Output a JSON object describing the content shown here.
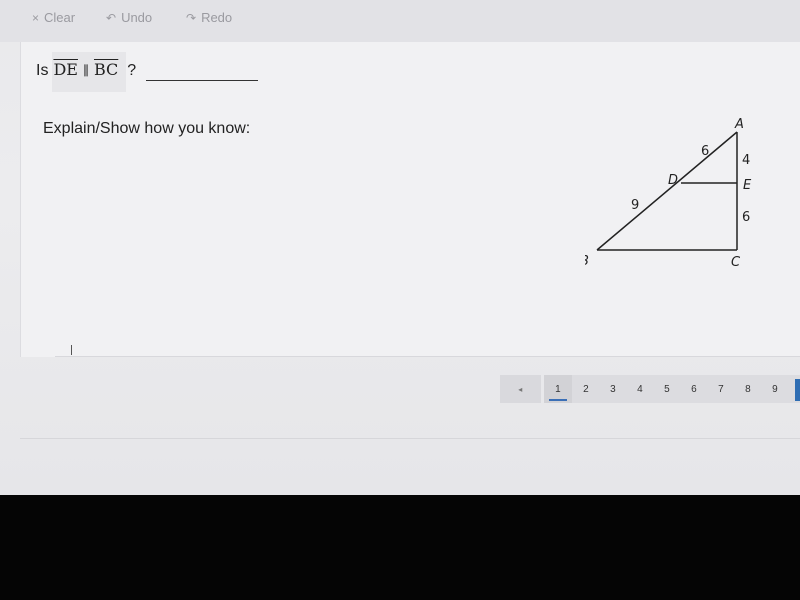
{
  "toolbar": {
    "clear": {
      "icon": "×",
      "label": "Clear"
    },
    "undo": {
      "icon": "↶",
      "label": "Undo"
    },
    "redo": {
      "icon": "↷",
      "label": "Redo"
    }
  },
  "question": {
    "prefix": "Is",
    "segment1": "DE",
    "parallel_symbol": "∥",
    "segment2": "BC",
    "suffix": "?"
  },
  "explain_prompt": "Explain/Show how you know:",
  "diagram": {
    "vertices": {
      "A": "A",
      "B": "B",
      "C": "C",
      "D": "D",
      "E": "E"
    },
    "lengths": {
      "AD": "6",
      "DB": "9",
      "AE": "4",
      "EC": "6"
    }
  },
  "pagination": {
    "prev_icon": "◂",
    "pages": [
      "1",
      "2",
      "3",
      "4",
      "5",
      "6",
      "7",
      "8",
      "9"
    ],
    "current": "1"
  }
}
